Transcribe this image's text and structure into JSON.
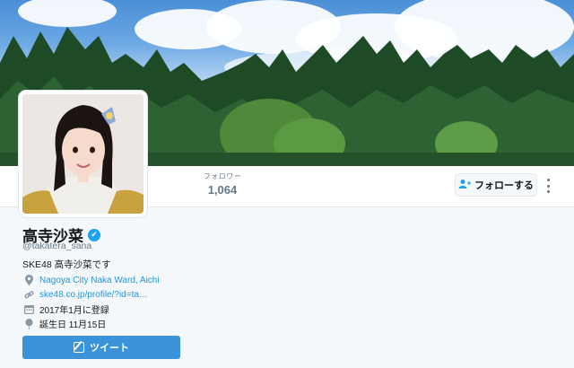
{
  "profile": {
    "name": "高寺沙菜",
    "verified_mark": "✔",
    "handle": "@takatera_sana",
    "bio": "SKE48 高寺沙菜です",
    "location": "Nagoya City Naka Ward, Aichi",
    "url": "ske48.co.jp/profile/?id=ta…",
    "joined": "2017年1月に登録",
    "birthday": "誕生日 11月15日"
  },
  "stats": {
    "followers_label": "フォロワー",
    "followers_value": "1,064"
  },
  "actions": {
    "follow_label": "フォローする",
    "tweet_label": "ツイート"
  },
  "icons": {
    "location": "location-pin-icon",
    "url": "link-icon",
    "joined": "calendar-icon",
    "birthday": "balloon-icon",
    "follow": "add-user-icon",
    "more": "more-vertical-icon",
    "tweet": "compose-icon"
  },
  "colors": {
    "accent": "#1da1f2",
    "link": "#1b95e0",
    "tweet_button": "#3b94d9",
    "muted": "#657786"
  }
}
